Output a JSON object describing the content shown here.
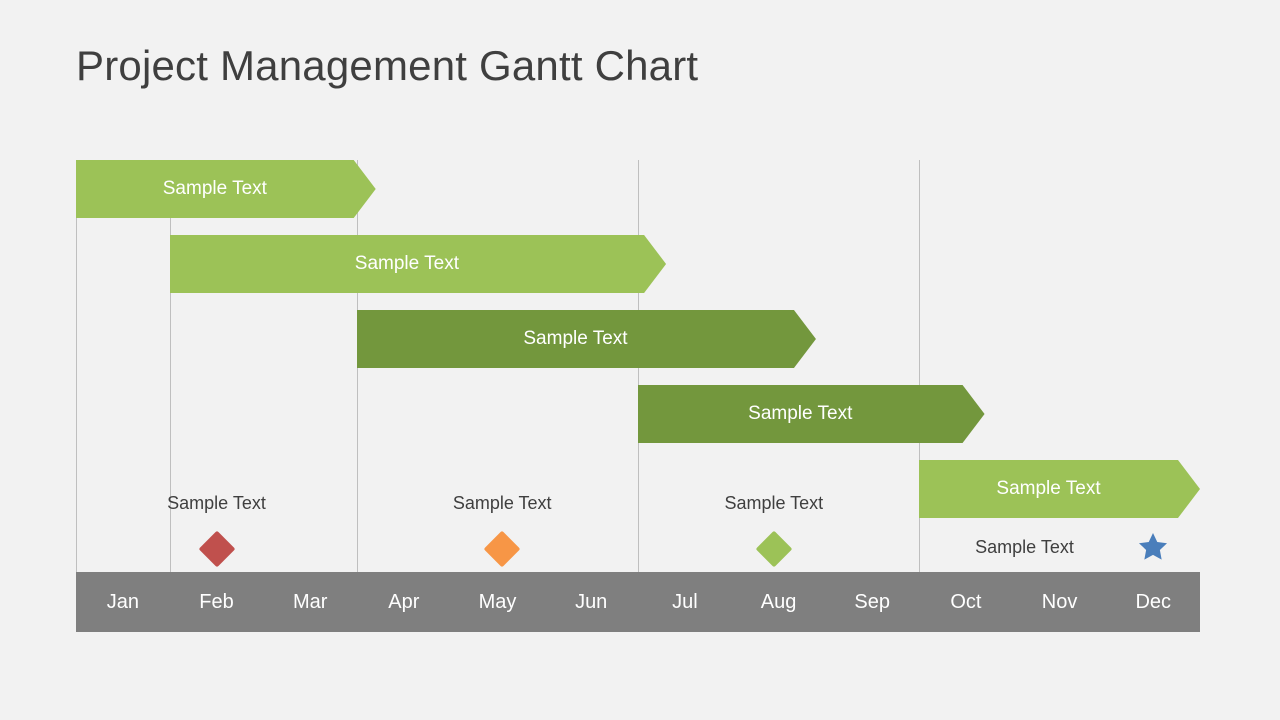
{
  "title": "Project Management Gantt Chart",
  "colors": {
    "background": "#f2f2f2",
    "title_text": "#3f3f3f",
    "axis_bar": "#7f7f7f",
    "axis_text": "#ffffff",
    "gridline": "#bfbfbf",
    "bar_light_green": "#9cc257",
    "bar_dark_green": "#73973d",
    "milestone_red": "#c0504d",
    "milestone_orange": "#f79646",
    "milestone_green": "#9cc257",
    "milestone_blue": "#4a7ebb",
    "bar_text": "#ffffff",
    "milestone_text": "#3f3f3f"
  },
  "chart_data": {
    "type": "bar",
    "orientation": "horizontal",
    "subtype": "gantt",
    "title": "Project Management Gantt Chart",
    "xlabel": "",
    "ylabel": "",
    "grid": true,
    "legend": "none",
    "categories": [
      "Jan",
      "Feb",
      "Mar",
      "Apr",
      "May",
      "Jun",
      "Jul",
      "Aug",
      "Sep",
      "Oct",
      "Nov",
      "Dec"
    ],
    "axis_months": [
      "Jan",
      "Feb",
      "Mar",
      "Apr",
      "May",
      "Jun",
      "Jul",
      "Aug",
      "Sep",
      "Oct",
      "Nov",
      "Dec"
    ],
    "tasks": [
      {
        "label": "Sample Text",
        "start_month": "Jan",
        "end_month": "Mar",
        "start_index": 0,
        "end_index": 3.2,
        "color": "#9cc257",
        "row": 1
      },
      {
        "label": "Sample Text",
        "start_month": "Feb",
        "end_month": "Jun",
        "start_index": 1,
        "end_index": 6.3,
        "color": "#9cc257",
        "row": 2
      },
      {
        "label": "Sample Text",
        "start_month": "Apr",
        "end_month": "Aug",
        "start_index": 3,
        "end_index": 7.9,
        "color": "#73973d",
        "row": 3
      },
      {
        "label": "Sample Text",
        "start_month": "Jul",
        "end_month": "Oct",
        "start_index": 6,
        "end_index": 9.7,
        "color": "#73973d",
        "row": 4
      },
      {
        "label": "Sample Text",
        "start_month": "Oct",
        "end_month": "Dec",
        "start_index": 9,
        "end_index": 12,
        "color": "#9cc257",
        "row": 5
      }
    ],
    "milestones": [
      {
        "label": "Sample Text",
        "month": "Feb",
        "index": 1.5,
        "shape": "diamond",
        "color": "#c0504d",
        "label_position": "above"
      },
      {
        "label": "Sample Text",
        "month": "May",
        "index": 4.55,
        "shape": "diamond",
        "color": "#f79646",
        "label_position": "above"
      },
      {
        "label": "Sample Text",
        "month": "Aug",
        "index": 7.45,
        "shape": "diamond",
        "color": "#9cc257",
        "label_position": "above"
      },
      {
        "label": "Sample Text",
        "month": "Dec",
        "index": 11.5,
        "shape": "star",
        "color": "#4a7ebb",
        "label_position": "left"
      }
    ],
    "gridline_indices": [
      0,
      1,
      3,
      6,
      9
    ]
  }
}
